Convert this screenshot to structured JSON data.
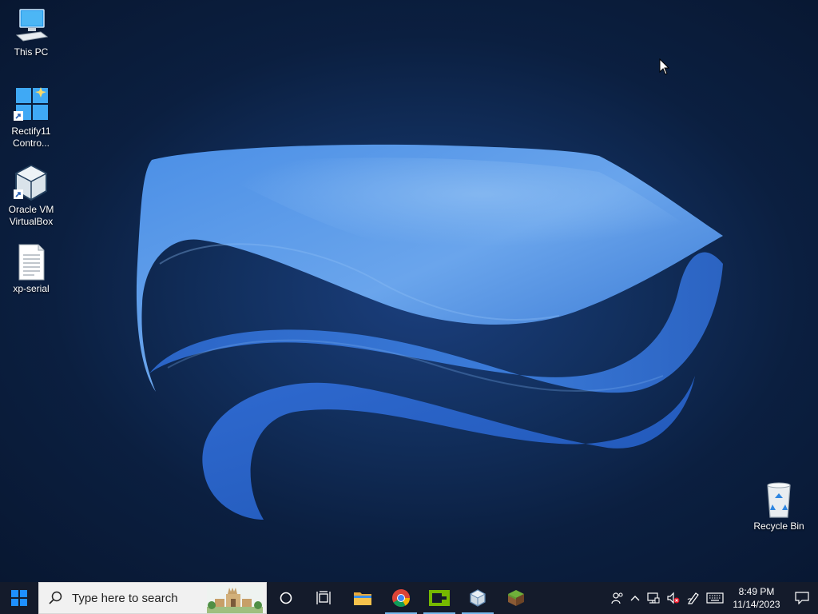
{
  "desktop": {
    "icons": [
      {
        "label": "This PC",
        "icon": "this-pc-icon"
      },
      {
        "label": "Rectify11 Contro...",
        "icon": "rectify11-control-icon"
      },
      {
        "label": "Oracle VM VirtualBox",
        "icon": "virtualbox-icon"
      },
      {
        "label": "xp-serial",
        "icon": "text-document-icon"
      },
      {
        "label": "Recycle Bin",
        "icon": "recycle-bin-icon"
      }
    ]
  },
  "taskbar": {
    "search": {
      "placeholder": "Type here to search"
    },
    "pinned": [
      {
        "name": "cortana-button",
        "icon": "circle-icon",
        "running": false
      },
      {
        "name": "task-view-button",
        "icon": "task-view-icon",
        "running": false
      },
      {
        "name": "file-explorer-button",
        "icon": "folder-icon",
        "running": false
      },
      {
        "name": "chrome-button",
        "icon": "chrome-icon",
        "running": true
      },
      {
        "name": "nvidia-app-button",
        "icon": "nvidia-icon",
        "running": true
      },
      {
        "name": "virtualbox-button",
        "icon": "virtualbox-icon",
        "running": true
      },
      {
        "name": "minecraft-button",
        "icon": "minecraft-icon",
        "running": false
      }
    ],
    "tray": {
      "icons": [
        "people-icon",
        "chevron-up-icon",
        "network-icon",
        "volume-muted-icon",
        "pen-icon",
        "keyboard-icon"
      ],
      "time": "8:49 PM",
      "date": "11/14/2023"
    }
  },
  "colors": {
    "taskbar": "#141b2b",
    "search_bg": "#f1f1f1",
    "running_indicator": "#76b9ed",
    "wallpaper_accent": "#3a7bd5"
  }
}
